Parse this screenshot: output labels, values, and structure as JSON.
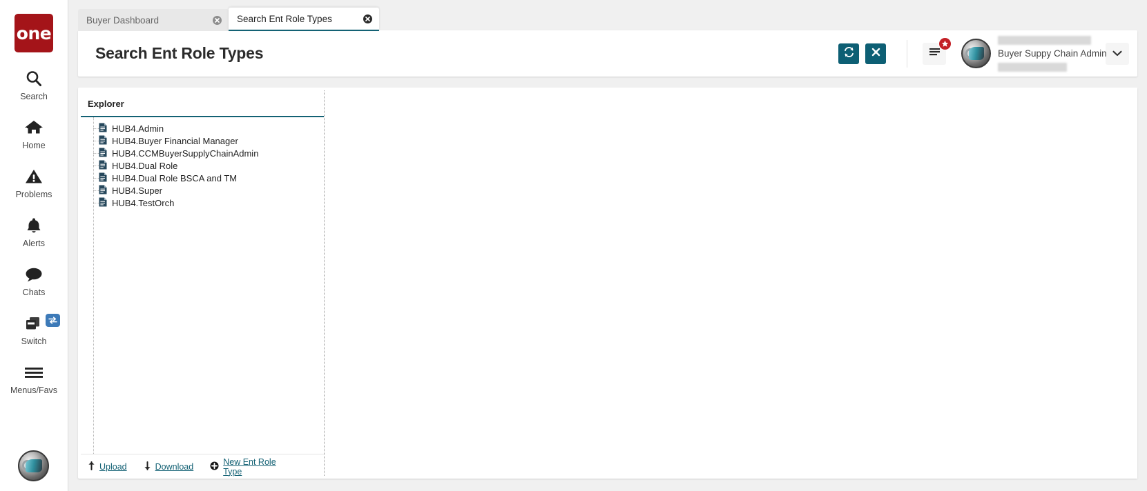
{
  "brand": {
    "logo_text": "one"
  },
  "sidebar": {
    "items": [
      {
        "label": "Search",
        "icon": "search-icon"
      },
      {
        "label": "Home",
        "icon": "home-icon"
      },
      {
        "label": "Problems",
        "icon": "warning-triangle-icon"
      },
      {
        "label": "Alerts",
        "icon": "bell-icon"
      },
      {
        "label": "Chats",
        "icon": "chat-bubble-icon"
      },
      {
        "label": "Switch",
        "icon": "switch-windows-icon",
        "badge_icon": "swap-arrows-icon"
      },
      {
        "label": "Menus/Favs",
        "icon": "hamburger-icon"
      }
    ],
    "avatar": "user-avatar"
  },
  "tabs": [
    {
      "label": "Buyer Dashboard",
      "active": false,
      "close_icon": "close-circle-icon"
    },
    {
      "label": "Search Ent Role Types",
      "active": true,
      "close_icon": "close-circle-icon"
    }
  ],
  "header": {
    "title": "Search Ent Role Types",
    "refresh_icon": "refresh-icon",
    "close_icon": "x-icon",
    "menu_icon": "hamburger-menu-icon",
    "favorites_badge_icon": "star-icon",
    "user_name": "Buyer Suppy Chain Admin",
    "caret_icon": "chevron-down-icon",
    "redacted_top": "",
    "redacted_bottom": ""
  },
  "explorer": {
    "title": "Explorer",
    "items": [
      {
        "name": "HUB4.Admin",
        "icon": "document-icon"
      },
      {
        "name": "HUB4.Buyer Financial Manager",
        "icon": "document-icon"
      },
      {
        "name": "HUB4.CCMBuyerSupplyChainAdmin",
        "icon": "document-icon"
      },
      {
        "name": "HUB4.Dual Role",
        "icon": "document-icon"
      },
      {
        "name": "HUB4.Dual Role BSCA and TM",
        "icon": "document-icon"
      },
      {
        "name": "HUB4.Super",
        "icon": "document-icon"
      },
      {
        "name": "HUB4.TestOrch",
        "icon": "document-icon"
      }
    ],
    "footer": {
      "upload": "Upload",
      "upload_icon": "arrow-up-icon",
      "download": "Download",
      "download_icon": "arrow-down-icon",
      "new_item": "New Ent Role Type",
      "new_item_icon": "plus-circle-icon"
    }
  },
  "colors": {
    "brand_red": "#a41419",
    "accent_teal": "#136174",
    "button_teal": "#0d5f74",
    "badge_red": "#c32026",
    "switch_badge_blue": "#3d7ab8",
    "page_bg": "#f0f0f0"
  }
}
